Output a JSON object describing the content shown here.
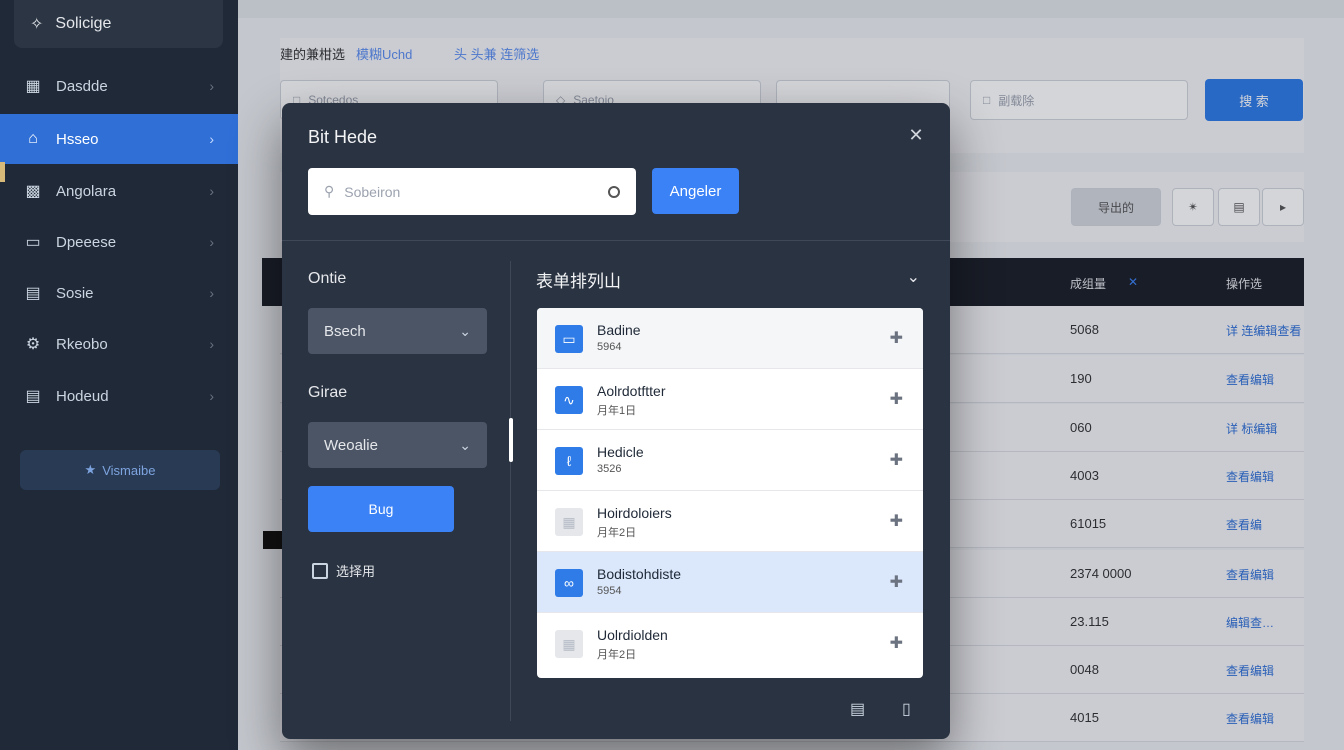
{
  "sidebar": {
    "brand": "Solicige",
    "items": [
      {
        "label": "Dasdde",
        "icon": "dashboard-icon"
      },
      {
        "label": "Hsseo",
        "icon": "home-icon"
      },
      {
        "label": "Angolara",
        "icon": "chart-icon"
      },
      {
        "label": "Dpeeese",
        "icon": "card-icon"
      },
      {
        "label": "Sosie",
        "icon": "briefcase-icon"
      },
      {
        "label": "Rkeobo",
        "icon": "settings-icon"
      },
      {
        "label": "Hodeud",
        "icon": "document-icon"
      }
    ],
    "bottom_button": "Vismaibe"
  },
  "main": {
    "filter_title": "建的兼柑选",
    "filter_link": "模糊Uchd",
    "filter_hint": "头 头兼 连筛选",
    "field_1": "Sotcedos",
    "field_2": "Saetoio",
    "field_4": "副载除",
    "search_button": "搜 索",
    "export_button": "导出的",
    "columns": {
      "amount": "成组量",
      "action": "操作选"
    },
    "rows": [
      {
        "value": "5068",
        "action": "详 连编辑查看"
      },
      {
        "value": "190",
        "action": "查看编辑"
      },
      {
        "value": "060",
        "action": "详 标编辑"
      },
      {
        "value": "4003",
        "action": "查看编辑"
      },
      {
        "value": "61015",
        "action": "查看编"
      },
      {
        "value": "2374 0000",
        "action": "查看编辑"
      },
      {
        "value": "23.115",
        "action": "编辑查…"
      },
      {
        "value": "0048",
        "action": "查看编辑"
      },
      {
        "value": "4015",
        "action": "查看编辑"
      }
    ]
  },
  "modal": {
    "title": "Bit Hede",
    "search_placeholder": "Sobeiron",
    "search_button": "Angeler",
    "left": {
      "label_1": "Ontie",
      "select_1": "Bsech",
      "label_2": "Girae",
      "select_2": "Weoalie",
      "apply_button": "Bug",
      "checkbox_label": "选择用"
    },
    "right": {
      "title": "表单排列山",
      "items": [
        {
          "name": "Badine",
          "sub": "5964",
          "icon": "window-icon",
          "style": "blue",
          "state": "normal"
        },
        {
          "name": "Aolrdotftter",
          "sub": "月年1日",
          "icon": "chart-line-icon",
          "style": "blue",
          "state": "normal"
        },
        {
          "name": "Hedicle",
          "sub": "3526",
          "icon": "pen-icon",
          "style": "blue",
          "state": "normal"
        },
        {
          "name": "Hoirdoloiers",
          "sub": "月年2日",
          "icon": "grid-icon",
          "style": "gray",
          "state": "normal"
        },
        {
          "name": "Bodistohdiste",
          "sub": "5954",
          "icon": "link-icon",
          "style": "blue",
          "state": "highlighted"
        },
        {
          "name": "Uolrdiolden",
          "sub": "月年2日",
          "icon": "table-icon",
          "style": "gray",
          "state": "normal"
        }
      ]
    }
  }
}
